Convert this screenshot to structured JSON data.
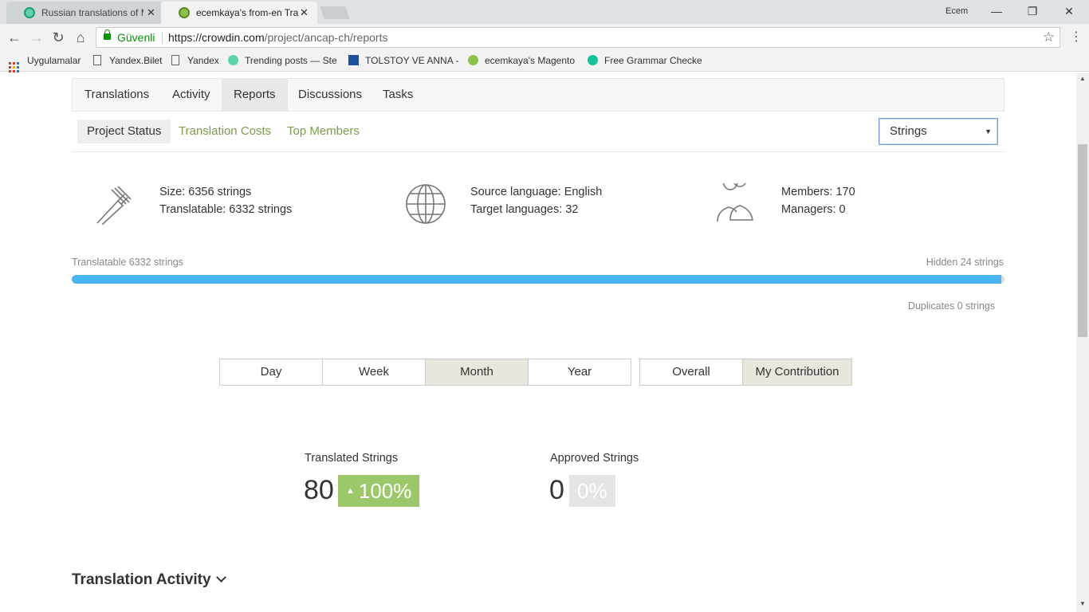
{
  "browser": {
    "tabs": [
      {
        "title": "Russian translations of M",
        "active": false
      },
      {
        "title": "ecemkaya's from-en Tran",
        "active": true
      }
    ],
    "user": "Ecem",
    "secure_label": "Güvenli",
    "url_prefix": "https://crowdin.com",
    "url_path": "/project/ancap-ch/reports",
    "bookmarks": [
      {
        "label": "Uygulamalar",
        "icon": "apps-icon"
      },
      {
        "label": "Yandex.Bilet",
        "icon": "page-icon"
      },
      {
        "label": "Yandex",
        "icon": "page-icon"
      },
      {
        "label": "Trending posts — Ste",
        "icon": "steemit-icon"
      },
      {
        "label": "TOLSTOY VE ANNA -",
        "icon": "book-icon"
      },
      {
        "label": "ecemkaya's Magento",
        "icon": "crowdin-icon"
      },
      {
        "label": "Free Grammar Checke",
        "icon": "grammarly-icon"
      }
    ]
  },
  "main_nav": [
    "Translations",
    "Activity",
    "Reports",
    "Discussions",
    "Tasks"
  ],
  "main_nav_active": "Reports",
  "sub_nav": [
    "Project Status",
    "Translation Costs",
    "Top Members"
  ],
  "sub_nav_active": "Project Status",
  "unit_select": {
    "value": "Strings"
  },
  "stats": {
    "size": "Size: 6356 strings",
    "translatable": "Translatable: 6332 strings",
    "source": "Source language: English",
    "targets": "Target languages: 32",
    "members": "Members: 170",
    "managers": "Managers: 0"
  },
  "progress": {
    "left_label": "Translatable 6332 strings",
    "right_label": "Hidden 24 strings",
    "duplicates_label": "Duplicates 0 strings",
    "fraction_translatable": 0.9962
  },
  "period_buttons": [
    "Day",
    "Week",
    "Month",
    "Year"
  ],
  "period_active": "Month",
  "scope_buttons": [
    "Overall",
    "My Contribution"
  ],
  "scope_active": "My Contribution",
  "metrics": {
    "translated": {
      "label": "Translated Strings",
      "value": "80",
      "change": "100%"
    },
    "approved": {
      "label": "Approved Strings",
      "value": "0",
      "change": "0%"
    }
  },
  "section_title": "Translation Activity",
  "colors": {
    "accent_link": "#7a9e4a",
    "progress_fill": "#48b5f0",
    "badge_up": "#9cc86a",
    "secure": "#0a8f08"
  }
}
